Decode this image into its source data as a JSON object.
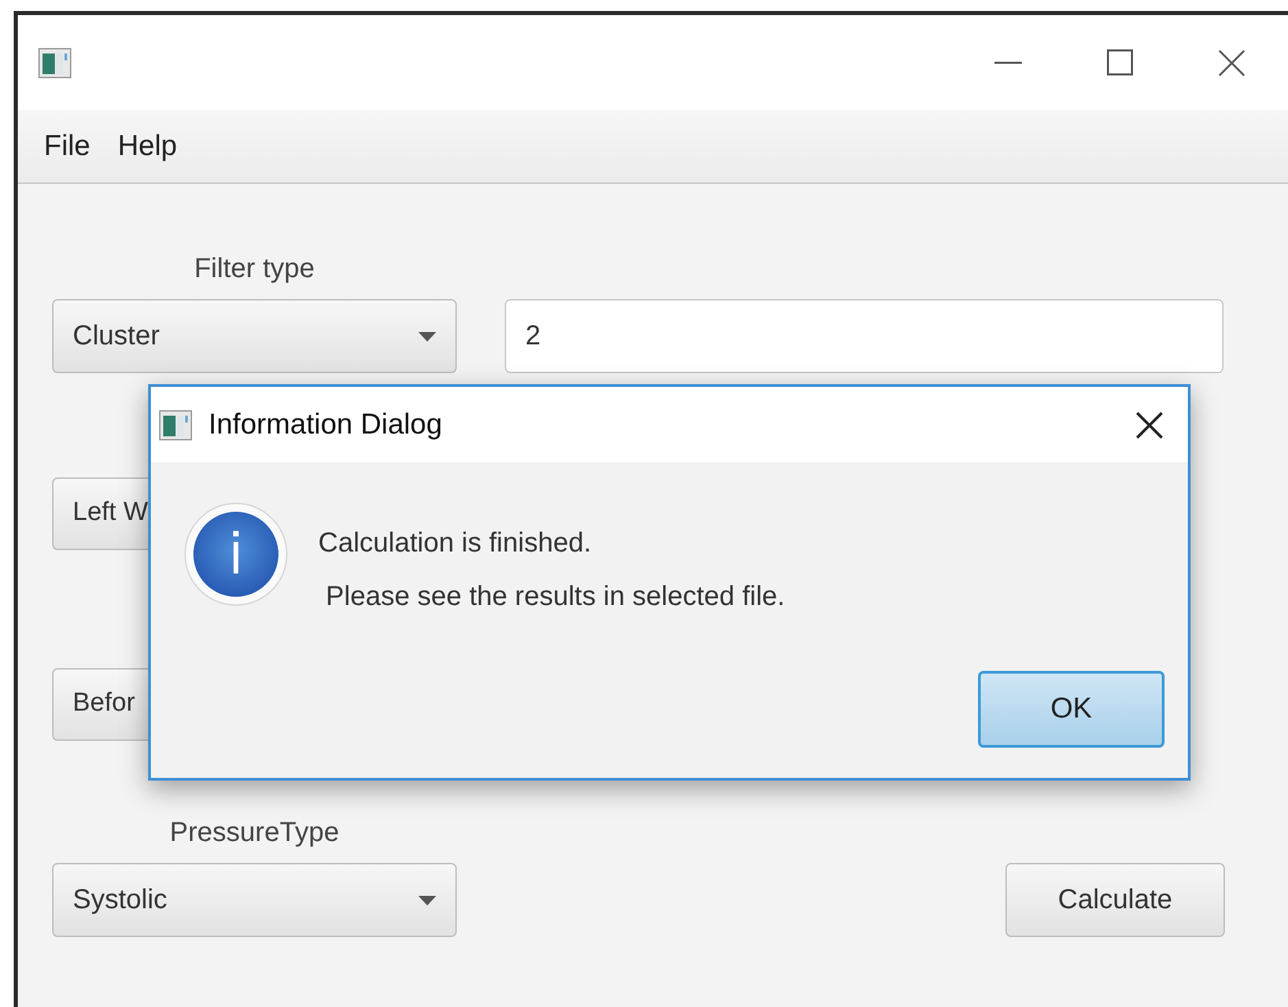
{
  "menu": [
    "File",
    "Help"
  ],
  "form": {
    "filter_type": {
      "label": "Filter type",
      "value": "Cluster"
    },
    "number_field": {
      "value": "2"
    },
    "buttons": [
      "Left W",
      "Befor"
    ],
    "pressure_type": {
      "label": "PressureType",
      "value": "Systolic"
    },
    "calculate": "Calculate"
  },
  "dialog": {
    "title": "Information Dialog",
    "message": "Calculation is finished.\n Please see the results in selected file.",
    "button": "OK"
  }
}
